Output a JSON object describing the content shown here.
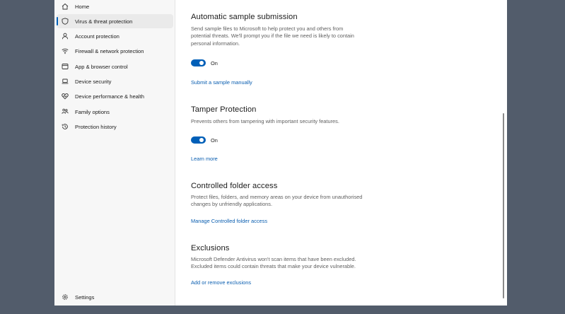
{
  "sidebar": {
    "items": [
      {
        "label": "Home",
        "icon": "home-icon"
      },
      {
        "label": "Virus & threat protection",
        "icon": "shield-icon"
      },
      {
        "label": "Account protection",
        "icon": "person-icon"
      },
      {
        "label": "Firewall & network protection",
        "icon": "wifi-icon"
      },
      {
        "label": "App & browser control",
        "icon": "app-window-icon"
      },
      {
        "label": "Device security",
        "icon": "laptop-icon"
      },
      {
        "label": "Device performance & health",
        "icon": "heart-icon"
      },
      {
        "label": "Family options",
        "icon": "family-icon"
      },
      {
        "label": "Protection history",
        "icon": "history-icon"
      }
    ],
    "settings_label": "Settings"
  },
  "sections": {
    "sample": {
      "title": "Automatic sample submission",
      "desc_line1": "Send sample files to Microsoft to help protect you and others from",
      "desc_line2": "potential threats. We'll prompt you if the file we need is likely to contain",
      "desc_line3": "personal information.",
      "toggle_label": "On",
      "link": "Submit a sample manually"
    },
    "tamper": {
      "title": "Tamper Protection",
      "desc_line1": "Prevents others from tampering with important security features.",
      "toggle_label": "On",
      "link": "Learn more"
    },
    "cfa": {
      "title": "Controlled folder access",
      "desc_line1": "Protect files, folders, and memory areas on your device from unauthorised",
      "desc_line2": "changes by unfriendly applications.",
      "link": "Manage Controlled folder access"
    },
    "exclusions": {
      "title": "Exclusions",
      "desc_line1": "Microsoft Defender Antivirus won't scan items that have been excluded.",
      "desc_line2": "Excluded items could contain threats that make your device vulnerable.",
      "link": "Add or remove exclusions"
    }
  },
  "colors": {
    "accent": "#005fb8",
    "link": "#0a5eb0",
    "desktop": "#525c6b"
  }
}
